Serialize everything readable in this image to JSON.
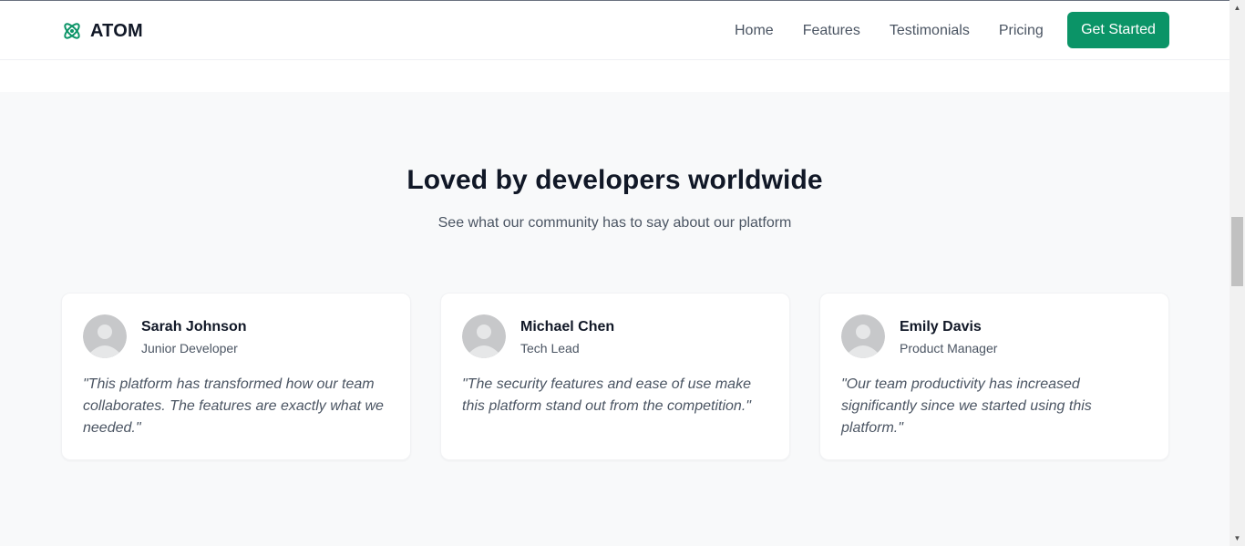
{
  "brand": {
    "name": "ATOM",
    "icon": "atom-icon",
    "accent_color": "#0b9467"
  },
  "nav": {
    "links": [
      {
        "label": "Home"
      },
      {
        "label": "Features"
      },
      {
        "label": "Testimonials"
      },
      {
        "label": "Pricing"
      }
    ],
    "cta_label": "Get Started"
  },
  "testimonials": {
    "title": "Loved by developers worldwide",
    "subtitle": "See what our community has to say about our platform",
    "items": [
      {
        "name": "Sarah Johnson",
        "role": "Junior Developer",
        "quote": "\"This platform has transformed how our team collaborates. The features are exactly what we needed.\""
      },
      {
        "name": "Michael Chen",
        "role": "Tech Lead",
        "quote": "\"The security features and ease of use make this platform stand out from the competition.\""
      },
      {
        "name": "Emily Davis",
        "role": "Product Manager",
        "quote": "\"Our team productivity has increased significantly since we started using this platform.\""
      }
    ]
  },
  "scrollbar": {
    "up_icon": "arrow-up-icon",
    "down_icon": "arrow-down-icon"
  }
}
